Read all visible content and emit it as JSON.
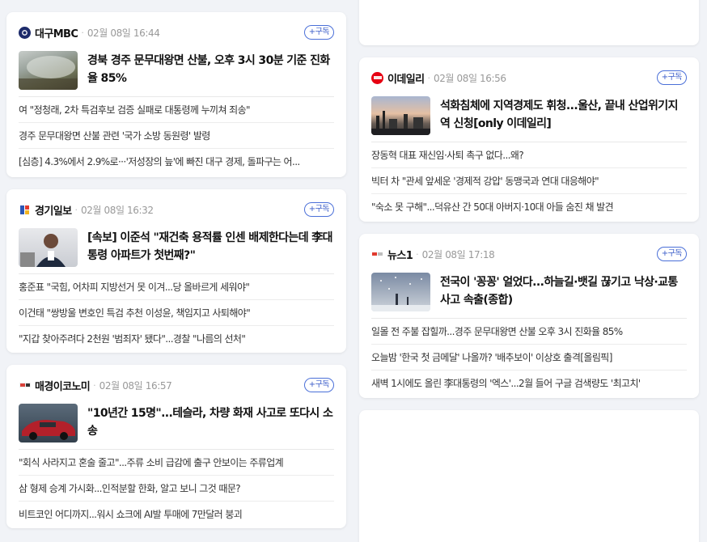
{
  "subscribe_label": "+구독",
  "left_column": [
    {
      "press": "대구MBC",
      "time": "02월 08일 16:44",
      "headline": "경북 경주 문무대왕면 산불, 오후 3시 30분 기준 진화율 85%",
      "items": [
        "여 \"정청래, 2차 특검후보 검증 실패로 대통령께 누끼쳐 죄송\"",
        "경주 문무대왕면 산불 관련 '국가 소방 동원령' 발령",
        "[심층] 4.3%에서 2.9%로···'저성장의 늪'에 빠진 대구 경제, 돌파구는 어..."
      ]
    },
    {
      "press": "경기일보",
      "time": "02월 08일 16:32",
      "headline": "[속보] 이준석 \"재건축 용적률 인센 배제한다는데 李대통령 아파트가 첫번째?\"",
      "items": [
        "홍준표 \"국힘, 어차피 지방선거 못 이겨...당 올바르게 세워야\"",
        "이건태 \"쌍방울 변호인 특검 추천 이성윤, 책임지고 사퇴해야\"",
        "\"지갑 찾아주려다 2천원 '범죄자' 됐다\"...경찰 \"나름의 선처\""
      ]
    },
    {
      "press": "매경이코노미",
      "time": "02월 08일 16:57",
      "headline": "\"10년간 15명\"...테슬라, 차량 화재 사고로 또다시 소송",
      "items": [
        "\"회식 사라지고 혼술 줄고\"...주류 소비 급감에 출구 안보이는 주류업계",
        "삼 형제 승계 가시화...인적분할 한화, 알고 보니 그것 때문?",
        "비트코인 어디까지...워시 쇼크에 AI발 투매에 7만달러 붕괴"
      ]
    }
  ],
  "right_column": [
    {
      "press": "이데일리",
      "time": "02월 08일 16:56",
      "headline": "석화침체에 지역경제도 휘청...울산, 끝내 산업위기지역 신청[only 이데일리]",
      "items": [
        "장동혁 대표 재신임·사퇴 촉구 없다...왜?",
        "빅터 차 \"관세 앞세운 '경제적 강압' 동맹국과 연대 대응해야\"",
        "\"숙소 못 구해\"...덕유산 간 50대 아버지·10대 아들 숨진 채 발견"
      ]
    },
    {
      "press": "뉴스1",
      "time": "02월 08일 17:18",
      "headline": "전국이 '꽁꽁' 얼었다...하늘길·뱃길 끊기고 낙상·교통사고 속출(종합)",
      "items": [
        "일몰 전 주불 잡힐까...경주 문무대왕면 산불 오후 3시 진화율 85%",
        "오늘밤 '한국 첫 금메달' 나올까? '배추보이' 이상호 출격[올림픽]",
        "새벽 1시에도 올린 李대통령의 '엑스'...2월 들어 구글 검색량도 '최고치'"
      ]
    }
  ],
  "colors": {
    "accent": "#3a5cc9",
    "background": "#f1f3f7",
    "card": "#ffffff"
  }
}
